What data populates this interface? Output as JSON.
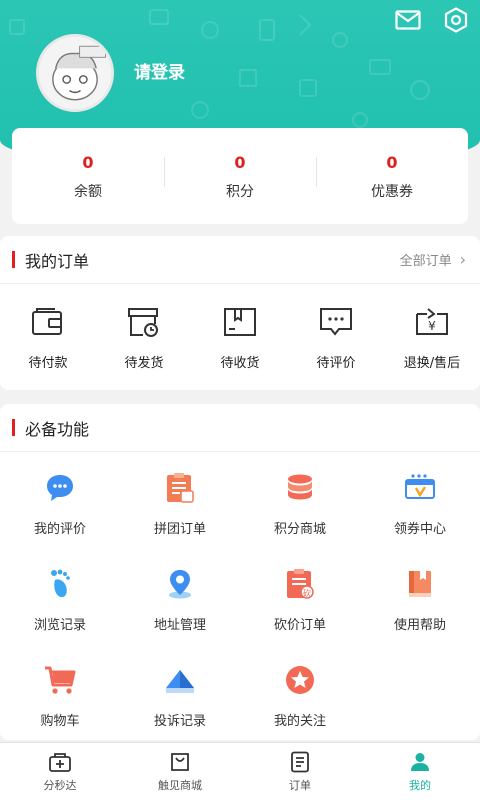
{
  "header": {
    "login_text": "请登录",
    "bg_color": "#1fbfae"
  },
  "stats": [
    {
      "value": "0",
      "label": "余额"
    },
    {
      "value": "0",
      "label": "积分"
    },
    {
      "value": "0",
      "label": "优惠券"
    }
  ],
  "orders": {
    "title": "我的订单",
    "more_label": "全部订单",
    "items": [
      {
        "label": "待付款",
        "icon": "wallet-icon"
      },
      {
        "label": "待发货",
        "icon": "box-clock-icon"
      },
      {
        "label": "待收货",
        "icon": "package-icon"
      },
      {
        "label": "待评价",
        "icon": "comment-icon"
      },
      {
        "label": "退换/售后",
        "icon": "yen-return-icon"
      }
    ]
  },
  "functions": {
    "title": "必备功能",
    "items": [
      {
        "label": "我的评价",
        "icon": "chat-bubble-icon"
      },
      {
        "label": "拼团订单",
        "icon": "group-order-icon"
      },
      {
        "label": "积分商城",
        "icon": "coins-stack-icon"
      },
      {
        "label": "领券中心",
        "icon": "coupon-icon"
      },
      {
        "label": "浏览记录",
        "icon": "footprint-icon"
      },
      {
        "label": "地址管理",
        "icon": "location-pin-icon"
      },
      {
        "label": "砍价订单",
        "icon": "bargain-icon"
      },
      {
        "label": "使用帮助",
        "icon": "help-book-icon"
      },
      {
        "label": "购物车",
        "icon": "cart-icon"
      },
      {
        "label": "投诉记录",
        "icon": "complaint-icon"
      },
      {
        "label": "我的关注",
        "icon": "star-icon"
      }
    ]
  },
  "tabbar": {
    "active_color": "#1ab3a3",
    "items": [
      {
        "label": "分秒达",
        "icon": "flash-box-icon"
      },
      {
        "label": "触见商城",
        "icon": "shopping-bag-icon"
      },
      {
        "label": "订单",
        "icon": "order-doc-icon"
      },
      {
        "label": "我的",
        "icon": "person-icon"
      }
    ]
  }
}
